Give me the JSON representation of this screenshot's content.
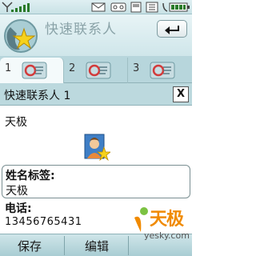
{
  "header": {
    "title": "快速联系人"
  },
  "tabs": [
    {
      "num": "1"
    },
    {
      "num": "2"
    },
    {
      "num": "3"
    }
  ],
  "panel": {
    "title": "快速联系人 1",
    "close_label": "X",
    "contact_name": "天极",
    "name_label": "姓名标签:",
    "name_value": "天极",
    "phone_label": "电话:",
    "phone_value": "13456765431"
  },
  "softkeys": {
    "save": "保存",
    "edit": "编辑"
  },
  "watermark": {
    "text": "天极",
    "url": "yesky.com"
  },
  "colors": {
    "accent_orange": "#f08a00",
    "chrome_blue": "#bcd9de"
  },
  "icons": {
    "app": "contact-star-icon",
    "back": "back-arrow-icon",
    "tab": "contact-card-icon",
    "avatar": "person-star-icon"
  }
}
